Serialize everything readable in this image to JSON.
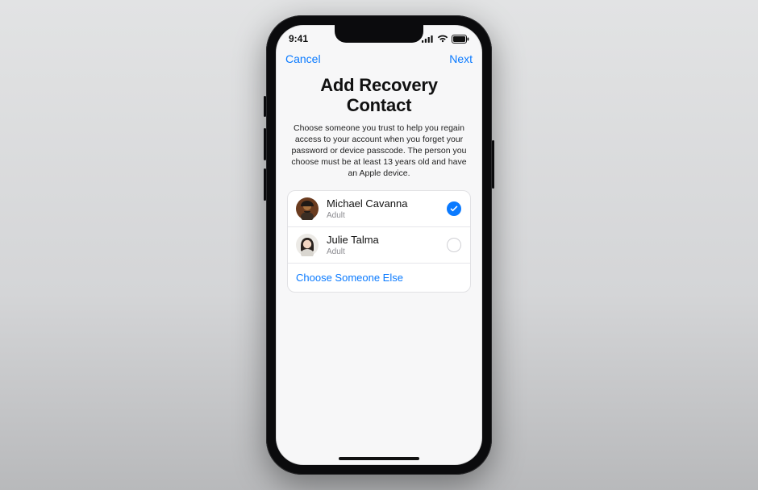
{
  "status": {
    "time": "9:41"
  },
  "nav": {
    "cancel": "Cancel",
    "next": "Next"
  },
  "page": {
    "title_line1": "Add Recovery",
    "title_line2": "Contact",
    "description": "Choose someone you trust to help you regain access to your account when you forget your password or device passcode. The person you choose must be at least 13 years old and have an Apple device."
  },
  "contacts": [
    {
      "name": "Michael Cavanna",
      "role": "Adult",
      "selected": true
    },
    {
      "name": "Julie Talma",
      "role": "Adult",
      "selected": false
    }
  ],
  "choose_else": "Choose Someone Else"
}
